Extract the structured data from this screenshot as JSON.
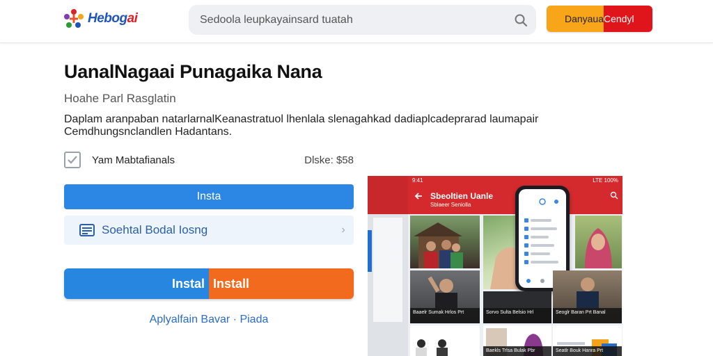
{
  "header": {
    "logo_part1": "Hebog",
    "logo_part2": "ai",
    "search_placeholder": "Sedoola  leupkayainsard tuatah",
    "cta_left": "Danyaua",
    "cta_right": "Cendyl"
  },
  "main": {
    "title": "UanalNagaai Punagaika Nana",
    "subtitle": "Hoahe Parl Rasglatin",
    "description": "Daplam  aranpaban natarlarnalKeanastratuol lhenlala slenagahkad dadiaplcadeprarad laumapair Cemdhungsnclandlen Hadantans.",
    "checkbox_label": "Yam Mabtafianals",
    "checkbox_meta": "Dlske: $58",
    "primary_button": "Insta",
    "list_item_text": "Soehtal Bodal Iosng",
    "install_left": "Instal",
    "install_right": "Install",
    "link_text": "Aplyalfain Bavar · Piada"
  },
  "preview": {
    "status_time": "9:41",
    "status_right": "LTE 100%",
    "appbar_title": "Sbeoltien Uanle",
    "appbar_subtitle": "Sblaeer Seniolla",
    "captions": [
      "Baaelr Sumak Hrlos Prt",
      "Sorvo Sulta Belsio Hrl",
      "Seoglr Baran Prt Banal",
      "Baekls Trlsa Bulak Pbr",
      "Seatlr Bouk Hanra Prt"
    ]
  },
  "colors": {
    "brand_blue": "#2b86e4",
    "brand_orange": "#f26a1d",
    "brand_red": "#d42a2e",
    "cta_yellow": "#f9a51a"
  }
}
